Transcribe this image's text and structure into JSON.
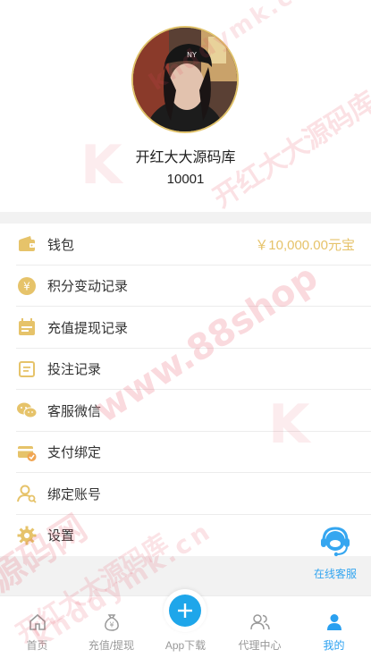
{
  "profile": {
    "username": "开红大大源码库",
    "user_id": "10001"
  },
  "menu": {
    "items": [
      {
        "label": "钱包",
        "value": "￥10,000.00元宝",
        "icon": "wallet-icon",
        "color": "#e6c36a"
      },
      {
        "label": "积分变动记录",
        "icon": "points-coin-icon",
        "color": "#e6c36a"
      },
      {
        "label": "充值提现记录",
        "icon": "calendar-record-icon",
        "color": "#e6c36a"
      },
      {
        "label": "投注记录",
        "icon": "document-list-icon",
        "color": "#e6c36a"
      },
      {
        "label": "客服微信",
        "icon": "wechat-icon",
        "color": "#e6c36a"
      },
      {
        "label": "支付绑定",
        "icon": "card-bind-icon",
        "color": "#e6c36a"
      },
      {
        "label": "绑定账号",
        "icon": "user-search-icon",
        "color": "#e6c36a"
      },
      {
        "label": "设置",
        "icon": "gear-icon",
        "color": "#e6c36a"
      }
    ]
  },
  "online_service": {
    "label": "在线客服",
    "icon": "headset-agent-icon",
    "color": "#35a6f0"
  },
  "tabbar": {
    "tabs": [
      {
        "label": "首页",
        "icon": "home-icon",
        "active": false
      },
      {
        "label": "充值/提现",
        "icon": "money-bag-icon",
        "active": false
      },
      {
        "label": "App下载",
        "icon": "plus-icon",
        "active": false
      },
      {
        "label": "代理中心",
        "icon": "users-icon",
        "active": false
      },
      {
        "label": "我的",
        "icon": "person-icon",
        "active": true
      }
    ],
    "active_color": "#2aa0f0",
    "inactive_color": "#999999"
  },
  "watermarks": [
    "K",
    "88shop",
    "www.88shop",
    "开红大大源码库",
    "khddymk.cn",
    "源码网"
  ]
}
